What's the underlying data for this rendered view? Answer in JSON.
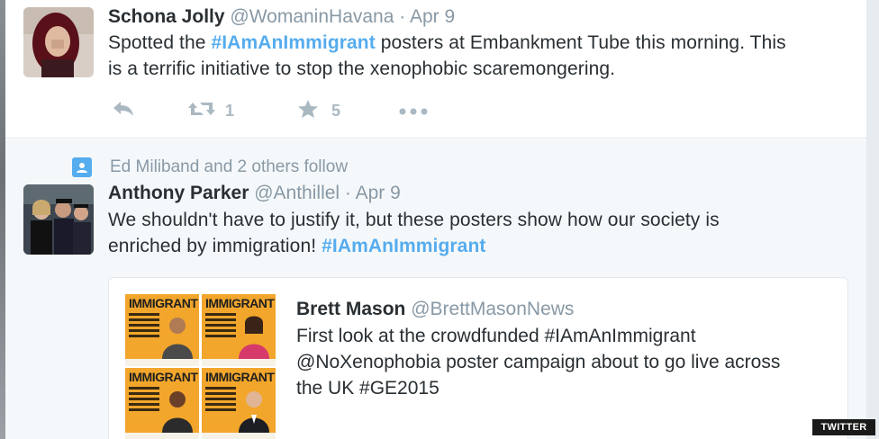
{
  "tweets": [
    {
      "name": "Schona Jolly",
      "handle": "@WomaninHavana",
      "separator": "·",
      "date": "Apr 9",
      "text_before": "Spotted the ",
      "hashtag": "#IAmAnImmigrant",
      "text_after_line1": " posters at Embankment Tube this morning. This",
      "text_line2": "is a terrific initiative to stop the xenophobic scaremongering.",
      "retweet_count": "1",
      "favorite_count": "5"
    },
    {
      "context": "Ed Miliband and 2 others follow",
      "name": "Anthony Parker",
      "handle": "@Anthillel",
      "separator": "·",
      "date": "Apr 9",
      "text_line1": "We shouldn't have to justify it, but these posters show how our society is",
      "text_line2_before": "enriched by immigration! ",
      "hashtag": "#IAmAnImmigrant",
      "quoted": {
        "name": "Brett Mason",
        "handle": "@BrettMasonNews",
        "line1": "First look at the crowdfunded  #IAmAnImmigrant",
        "line2": "@NoXenophobia poster campaign about to go live across",
        "line3": "the UK #GE2015",
        "posters": [
          "IMMIGRANT",
          "IMMIGRANT",
          "IMMIGRANT",
          "IMMIGRANT"
        ]
      }
    }
  ],
  "watermark": "TWITTER",
  "colors": {
    "hashtag": "#55acee",
    "muted": "#8899a6",
    "text": "#292f33",
    "action": "#aab8c2",
    "poster": "#f2a62b"
  },
  "icons": [
    "reply-icon",
    "retweet-icon",
    "favorite-star-icon",
    "more-dots-icon",
    "follow-context-icon"
  ]
}
